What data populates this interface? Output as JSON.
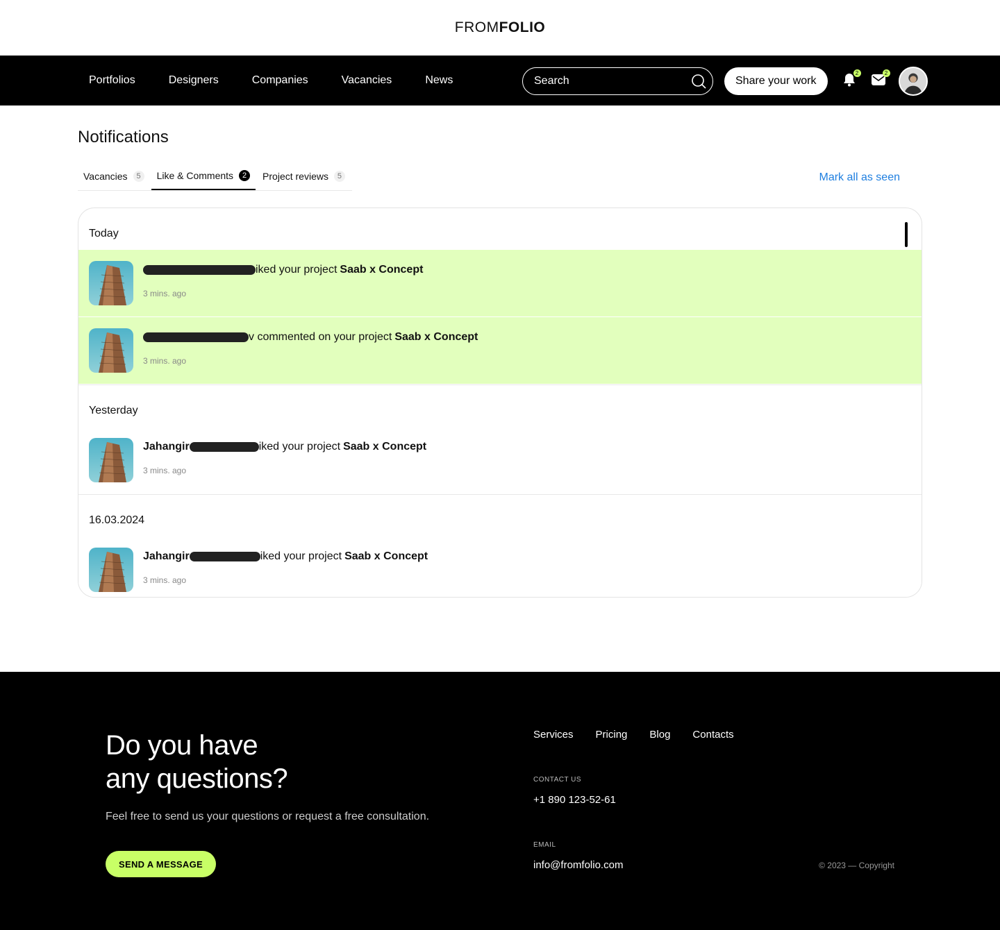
{
  "brand": {
    "logo_light": "FROM",
    "logo_bold": "FOLIO"
  },
  "nav": {
    "links": [
      "Portfolios",
      "Designers",
      "Companies",
      "Vacancies",
      "News"
    ],
    "search_placeholder": "Search",
    "share_label": "Share your work",
    "notifications_badge": "2",
    "messages_badge": "2"
  },
  "page": {
    "title": "Notifications",
    "mark_all_label": "Mark all as seen",
    "tabs": [
      {
        "label": "Vacancies",
        "count": "5"
      },
      {
        "label": "Like & Comments",
        "count": "2",
        "active": true
      },
      {
        "label": "Project reviews",
        "count": "5"
      }
    ]
  },
  "groups": [
    {
      "label": "Today",
      "items": [
        {
          "name": "",
          "action": "iked your project",
          "project": "Saab x Concept",
          "time": "3 mins. ago",
          "unread": true
        },
        {
          "name": "",
          "action": "v commented on your project",
          "project": "Saab x Concept",
          "time": "3 mins. ago",
          "unread": true
        }
      ]
    },
    {
      "label": "Yesterday",
      "items": [
        {
          "name": "Jahangir",
          "action": "iked your project",
          "project": "Saab x Concept",
          "time": "3 mins. ago",
          "unread": false
        }
      ]
    },
    {
      "label": "16.03.2024",
      "items": [
        {
          "name": "Jahangir",
          "action": "iked your project",
          "project": "Saab x Concept",
          "time": "3 mins. ago",
          "unread": false
        }
      ]
    }
  ],
  "footer": {
    "title_line1": "Do you have",
    "title_line2": "any questions?",
    "subtitle": "Feel free to send us your questions or request a free consultation.",
    "button": "SEND A MESSAGE",
    "links": [
      "Services",
      "Pricing",
      "Blog",
      "Contacts"
    ],
    "contact_label": "CONTACT US",
    "phone": "+1 890 123-52-61",
    "email_label": "EMAIL",
    "email": "info@fromfolio.com",
    "copyright": "© 2023 — Copyright"
  },
  "colors": {
    "accent": "#c8ff66",
    "unread_bg": "#e2ffbd",
    "link": "#1f7fe0"
  }
}
